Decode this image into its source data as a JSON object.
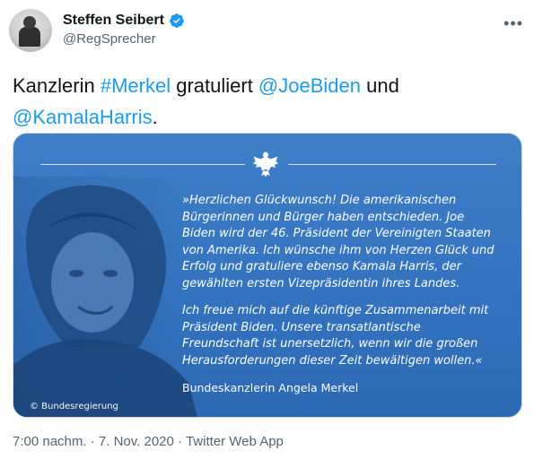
{
  "author": {
    "display_name": "Steffen Seibert",
    "handle": "@RegSprecher",
    "verified": true,
    "avatar_icon": "person-avatar"
  },
  "tweet": {
    "text_parts": [
      "Kanzlerin ",
      "#Merkel",
      " gratuliert ",
      "@JoeBiden",
      " und",
      "@KamalaHarris",
      "."
    ],
    "link_color": "#1d9bf0"
  },
  "media": {
    "quote_paragraphs": [
      "»Herzlichen Glückwunsch! Die amerikanischen Bürgerinnen und Bürger haben entschieden. Joe Biden wird der 46. Präsident der Vereinigten Staaten von Amerika. Ich wünsche ihm von Herzen Glück und Erfolg und gratuliere ebenso Kamala Harris, der gewählten ersten Vizepräsidentin ihres Landes.",
      "Ich freue mich auf die künftige Zusammenarbeit mit Präsident Biden. Unsere transatlantische Freundschaft ist unersetzlich, wenn wir die großen Herausforderungen dieser Zeit bewältigen wollen.«"
    ],
    "signature": "Bundeskanzlerin Angela Merkel",
    "copyright": "© Bundesregierung",
    "background_color": "#3a78c3",
    "emblem_icon": "federal-eagle-icon"
  },
  "meta": {
    "time": "7:00 nachm.",
    "date": "7. Nov. 2020",
    "source": "Twitter Web App",
    "separator": "·"
  }
}
